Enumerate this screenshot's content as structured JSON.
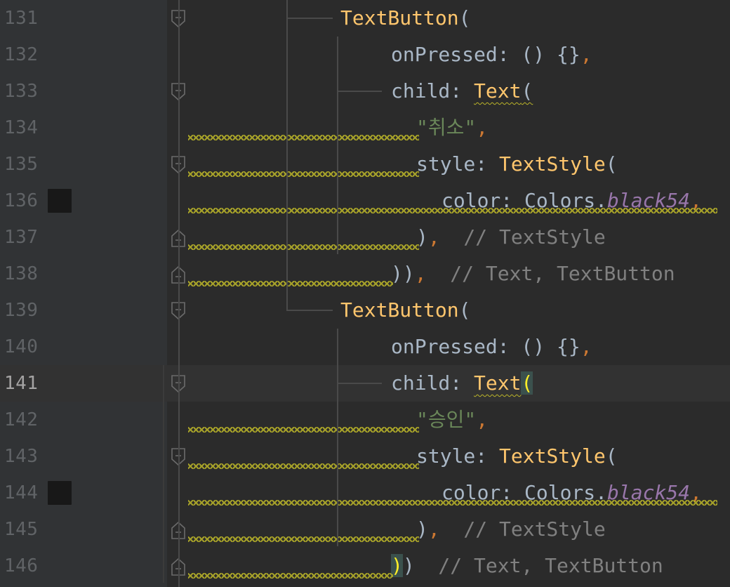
{
  "editor": {
    "lines": [
      {
        "num": "131",
        "indent": 485,
        "segments": [
          {
            "t": "TextButton",
            "c": "cls"
          },
          {
            "t": "(",
            "c": "plain"
          }
        ],
        "fold": "open",
        "swatch": false,
        "current": false
      },
      {
        "num": "132",
        "indent": 557,
        "segments": [
          {
            "t": "onPressed: () {}",
            "c": "plain"
          },
          {
            "t": ",",
            "c": "comma"
          }
        ],
        "fold": "",
        "swatch": false,
        "current": false
      },
      {
        "num": "133",
        "indent": 557,
        "segments": [
          {
            "t": "child: ",
            "c": "plain"
          },
          {
            "t": "Text",
            "c": "cls squig"
          },
          {
            "t": "(",
            "c": "plain squig"
          }
        ],
        "fold": "open",
        "swatch": false,
        "current": false
      },
      {
        "num": "134",
        "indent": 593,
        "segments": [
          {
            "t": "\"취소\"",
            "c": "str"
          },
          {
            "t": ",",
            "c": "comma"
          }
        ],
        "fold": "",
        "swatch": false,
        "current": false
      },
      {
        "num": "135",
        "indent": 593,
        "segments": [
          {
            "t": "style: ",
            "c": "plain"
          },
          {
            "t": "TextStyle",
            "c": "cls"
          },
          {
            "t": "(",
            "c": "plain"
          }
        ],
        "fold": "open",
        "swatch": false,
        "current": false
      },
      {
        "num": "136",
        "indent": 629,
        "segments": [
          {
            "t": "color: Colors.",
            "c": "plain"
          },
          {
            "t": "black54",
            "c": "ital"
          },
          {
            "t": ",",
            "c": "comma"
          }
        ],
        "fold": "",
        "swatch": true,
        "current": false
      },
      {
        "num": "137",
        "indent": 593,
        "segments": [
          {
            "t": ")",
            "c": "plain"
          },
          {
            "t": ",",
            "c": "comma"
          },
          {
            "t": "  // TextStyle",
            "c": "comment"
          }
        ],
        "fold": "close",
        "swatch": false,
        "current": false
      },
      {
        "num": "138",
        "indent": 557,
        "segments": [
          {
            "t": "))",
            "c": "plain"
          },
          {
            "t": ",",
            "c": "comma"
          },
          {
            "t": "  // Text, TextButton",
            "c": "comment"
          }
        ],
        "fold": "close",
        "swatch": false,
        "current": false
      },
      {
        "num": "139",
        "indent": 485,
        "segments": [
          {
            "t": "TextButton",
            "c": "cls"
          },
          {
            "t": "(",
            "c": "plain"
          }
        ],
        "fold": "open",
        "swatch": false,
        "current": false
      },
      {
        "num": "140",
        "indent": 557,
        "segments": [
          {
            "t": "onPressed: () {}",
            "c": "plain"
          },
          {
            "t": ",",
            "c": "comma"
          }
        ],
        "fold": "",
        "swatch": false,
        "current": false
      },
      {
        "num": "141",
        "indent": 557,
        "segments": [
          {
            "t": "child: ",
            "c": "plain"
          },
          {
            "t": "Text",
            "c": "cls squig"
          },
          {
            "t": "(",
            "c": "bracehl"
          }
        ],
        "fold": "open",
        "swatch": false,
        "current": true
      },
      {
        "num": "142",
        "indent": 593,
        "segments": [
          {
            "t": "\"승인\"",
            "c": "str"
          },
          {
            "t": ",",
            "c": "comma"
          }
        ],
        "fold": "",
        "swatch": false,
        "current": false
      },
      {
        "num": "143",
        "indent": 593,
        "segments": [
          {
            "t": "style: ",
            "c": "plain"
          },
          {
            "t": "TextStyle",
            "c": "cls"
          },
          {
            "t": "(",
            "c": "plain"
          }
        ],
        "fold": "open",
        "swatch": false,
        "current": false
      },
      {
        "num": "144",
        "indent": 629,
        "segments": [
          {
            "t": "color: Colors.",
            "c": "plain"
          },
          {
            "t": "black54",
            "c": "ital"
          },
          {
            "t": ",",
            "c": "comma"
          }
        ],
        "fold": "",
        "swatch": true,
        "current": false
      },
      {
        "num": "145",
        "indent": 593,
        "segments": [
          {
            "t": ")",
            "c": "plain"
          },
          {
            "t": ",",
            "c": "comma"
          },
          {
            "t": "  // TextStyle",
            "c": "comment"
          }
        ],
        "fold": "close",
        "swatch": false,
        "current": false
      },
      {
        "num": "146",
        "indent": 557,
        "segments": [
          {
            "t": ")",
            "c": "bracehl"
          },
          {
            "t": ")",
            "c": "plain"
          },
          {
            "t": "  // Text, TextButton",
            "c": "comment"
          }
        ],
        "fold": "close",
        "swatch": false,
        "current": false
      }
    ]
  },
  "colors": {
    "background": "#2b2b2b",
    "gutter": "#313335",
    "class_name": "#ffc66d",
    "string": "#6a8759",
    "keyword_comma": "#cc7832",
    "comment": "#808080",
    "static_field": "#9876aa",
    "warning_squiggle": "#bbb529",
    "color_swatch": "#181818"
  }
}
